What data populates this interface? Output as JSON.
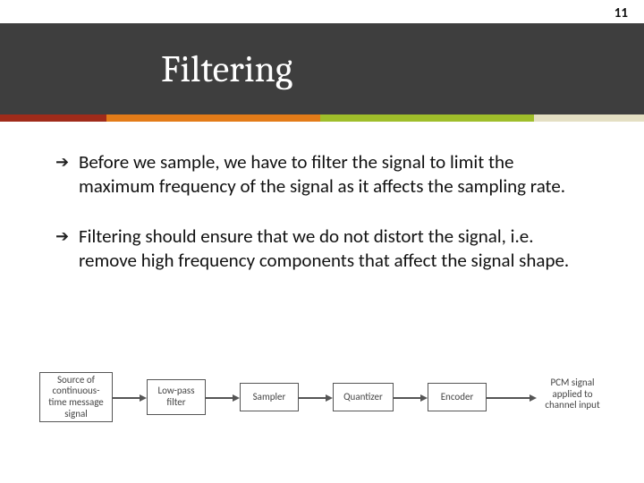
{
  "page_number": "11",
  "title": "Filtering",
  "bullets": [
    "Before we sample, we have to filter the signal to limit the maximum frequency of the signal as it affects the sampling rate.",
    "Filtering should ensure that we do not distort the signal, i.e. remove high frequency components that affect the signal shape."
  ],
  "diagram": {
    "boxes": [
      "Source of continuous-time message signal",
      "Low-pass filter",
      "Sampler",
      "Quantizer",
      "Encoder"
    ],
    "output_label": "PCM signal applied to channel input"
  }
}
